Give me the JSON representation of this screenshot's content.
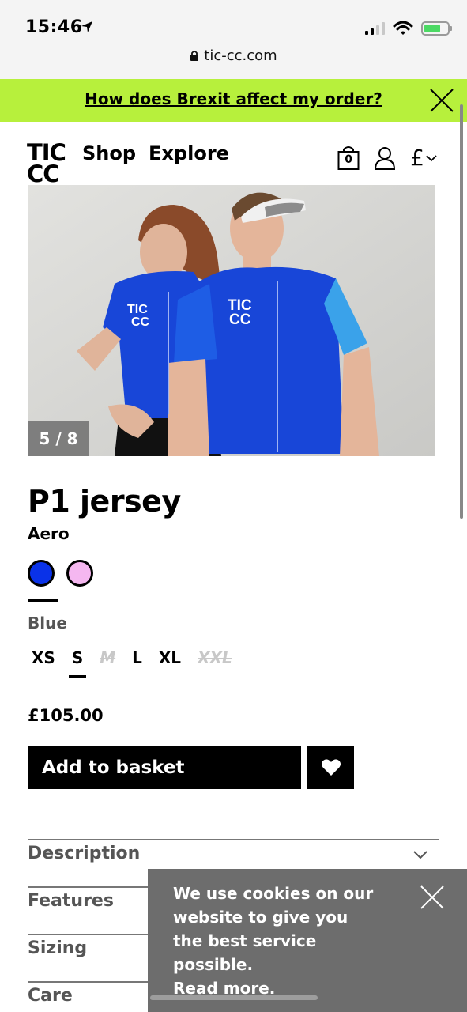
{
  "status_bar": {
    "time": "15:46",
    "url": "tic-cc.com"
  },
  "promo": {
    "text": "How does Brexit affect my order?"
  },
  "header": {
    "logo_line1": "TIC",
    "logo_line2": "CC",
    "nav": [
      "Shop",
      "Explore"
    ],
    "basket_count": "0",
    "currency_symbol": "£"
  },
  "gallery": {
    "counter": "5 / 8",
    "jersey_logo_line1": "TIC",
    "jersey_logo_line2": "CC"
  },
  "product": {
    "title": "P1 jersey",
    "subtitle": "Aero",
    "colors": [
      {
        "name": "Blue",
        "hex": "#0a32e8"
      },
      {
        "name": "Pink",
        "hex": "#f5b7f0"
      }
    ],
    "selected_color": "Blue",
    "sizes": [
      {
        "label": "XS",
        "available": true
      },
      {
        "label": "S",
        "available": true,
        "selected": true
      },
      {
        "label": "M",
        "available": false
      },
      {
        "label": "L",
        "available": true
      },
      {
        "label": "XL",
        "available": true
      },
      {
        "label": "XXL",
        "available": false
      }
    ],
    "price": "£105.00",
    "add_to_basket": "Add to basket"
  },
  "accordions": [
    "Description",
    "Features",
    "Sizing",
    "Care"
  ],
  "cookie": {
    "text": "We use cookies on our website to give you the best service possible.",
    "link": "Read more."
  },
  "colors": {
    "promo_bg": "#b7f03c",
    "button_bg": "#000000",
    "cookie_bg": "#6d6d6d"
  }
}
